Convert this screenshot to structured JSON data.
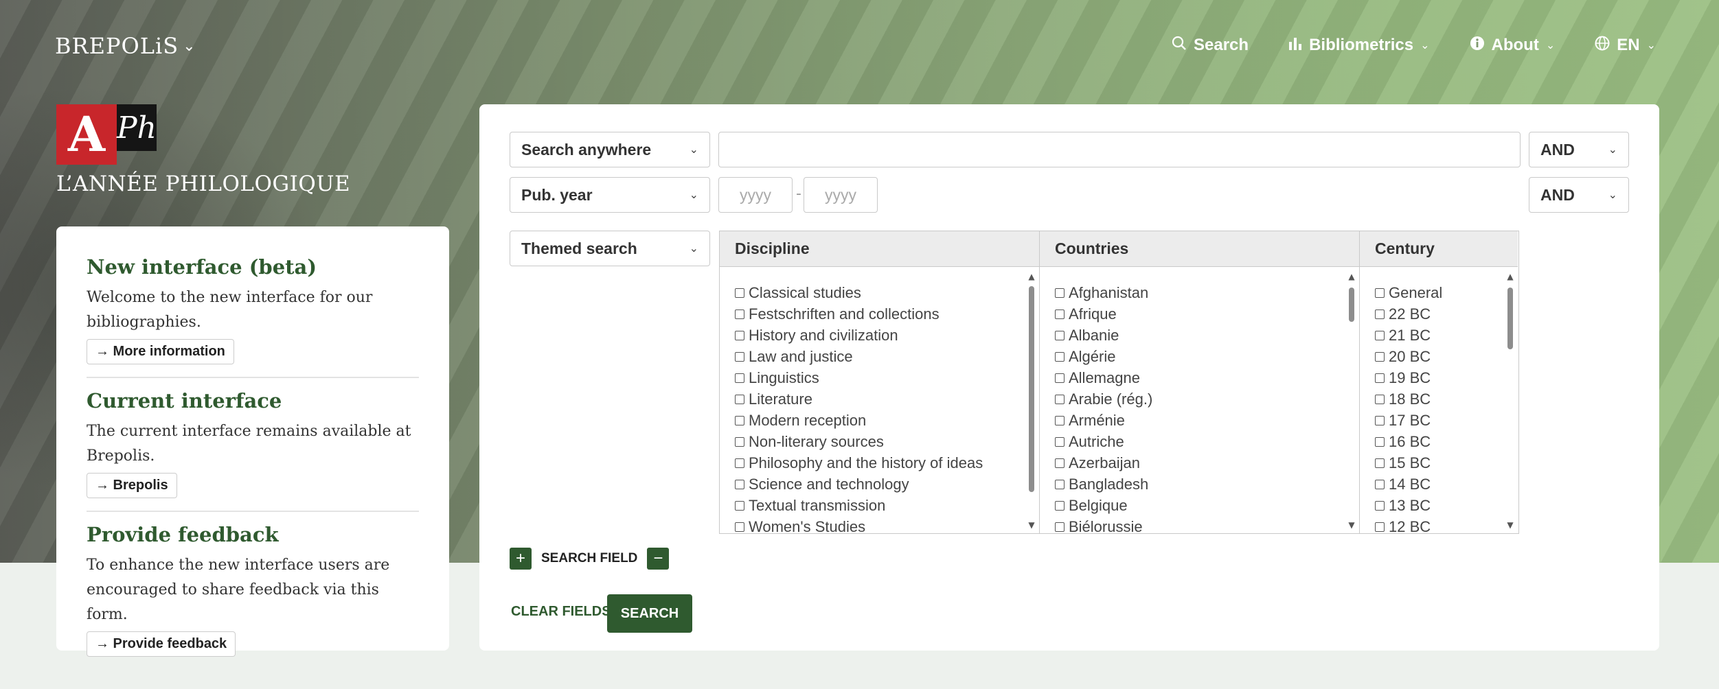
{
  "nav": {
    "brand": "BREPOLiS",
    "items": [
      {
        "label": "Search",
        "icon": "search-icon"
      },
      {
        "label": "Bibliometrics",
        "icon": "bar-chart-icon"
      },
      {
        "label": "About",
        "icon": "info-icon"
      },
      {
        "label": "EN",
        "icon": "globe-icon"
      }
    ]
  },
  "logo": {
    "letter_a": "A",
    "letters_ph": "Ph",
    "title": "L’ANNÉE PHILOLOGIQUE"
  },
  "info": {
    "new_interface": {
      "heading": "New interface (beta)",
      "text": "Welcome to the new interface for our bibliographies.",
      "button": "→ More information"
    },
    "current_interface": {
      "heading": "Current interface",
      "text": "The current interface remains available at Brepolis.",
      "button": "→ Brepolis"
    },
    "feedback": {
      "heading": "Provide feedback",
      "text": "To enhance the new interface users are encouraged to share feedback via this form.",
      "button": "→ Provide feedback"
    }
  },
  "search": {
    "row1": {
      "field": "Search anywhere",
      "value": "",
      "operator": "AND"
    },
    "row2": {
      "field": "Pub. year",
      "from_placeholder": "yyyy",
      "separator": "-",
      "to_placeholder": "yyyy",
      "operator": "AND"
    },
    "row3": {
      "field": "Themed search"
    },
    "columns": [
      {
        "header": "Discipline",
        "options": [
          "Classical studies",
          "Festschriften and collections",
          "History and civilization",
          "Law and justice",
          "Linguistics",
          "Literature",
          "Modern reception",
          "Non-literary sources",
          "Philosophy and the history of ideas",
          "Science and technology",
          "Textual transmission",
          "Women's Studies"
        ]
      },
      {
        "header": "Countries",
        "options": [
          "Afghanistan",
          "Afrique",
          "Albanie",
          "Algérie",
          "Allemagne",
          "Arabie (rég.)",
          "Arménie",
          "Autriche",
          "Azerbaijan",
          "Bangladesh",
          "Belgique",
          "Biélorussie"
        ]
      },
      {
        "header": "Century",
        "options": [
          "General",
          "22 BC",
          "21 BC",
          "20 BC",
          "19 BC",
          "18 BC",
          "17 BC",
          "16 BC",
          "15 BC",
          "14 BC",
          "13 BC",
          "12 BC"
        ]
      }
    ],
    "add_symbol": "+",
    "remove_symbol": "−",
    "field_label": "SEARCH FIELD",
    "clear_label": "CLEAR FIELDS",
    "search_label": "SEARCH"
  },
  "colors": {
    "accent": "#2f5a2f",
    "logo_red": "#c8262b",
    "hero_green": "#9cc084"
  }
}
